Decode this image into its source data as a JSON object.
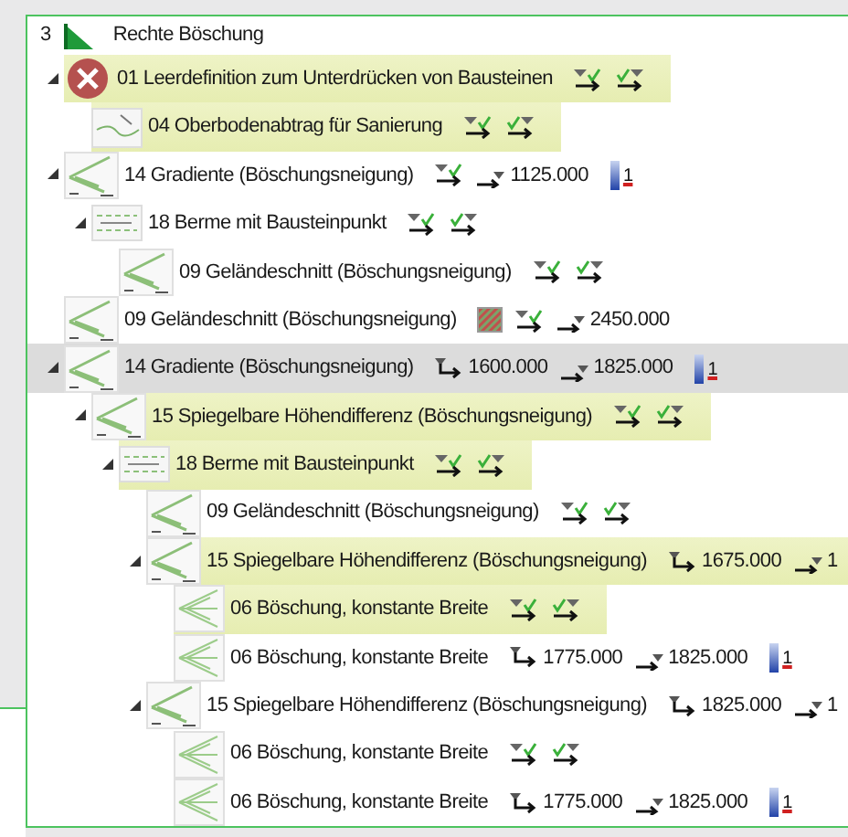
{
  "header": {
    "number": "3",
    "label": "Rechte Böschung"
  },
  "tree": [
    {
      "label": "01 Leerdefinition zum Unterdrücken von Bausteinen",
      "kind": "error",
      "expanded": true,
      "selected": false,
      "highlighted": true,
      "cells": [
        {
          "kind": "check-in"
        },
        {
          "kind": "check-out"
        }
      ],
      "children": [
        {
          "label": "04 Oberbodenabtrag für Sanierung",
          "kind": "topsoil",
          "selected": false,
          "highlighted": true,
          "cells": [
            {
              "kind": "check-in"
            },
            {
              "kind": "check-out"
            }
          ]
        }
      ]
    },
    {
      "label": "14 Gradiente (Böschungsneigung)",
      "kind": "slope",
      "expanded": true,
      "selected": false,
      "highlighted": false,
      "cells": [
        {
          "kind": "check-in"
        },
        {
          "kind": "out-value",
          "text": "1125.000"
        },
        {
          "kind": "bar",
          "text": "1"
        }
      ],
      "children": [
        {
          "label": "18 Berme mit Bausteinpunkt",
          "kind": "berm",
          "expanded": true,
          "selected": false,
          "highlighted": false,
          "cells": [
            {
              "kind": "check-in"
            },
            {
              "kind": "check-out"
            }
          ],
          "children": [
            {
              "label": "09 Geländeschnitt (Böschungsneigung)",
              "kind": "slope",
              "selected": false,
              "highlighted": false,
              "cells": [
                {
                  "kind": "check-in"
                },
                {
                  "kind": "check-out"
                }
              ]
            }
          ]
        }
      ]
    },
    {
      "label": "09 Geländeschnitt (Böschungsneigung)",
      "kind": "slope",
      "selected": false,
      "highlighted": false,
      "cells": [
        {
          "kind": "hatch"
        },
        {
          "kind": "check-in"
        },
        {
          "kind": "out-value",
          "text": "2450.000"
        }
      ]
    },
    {
      "label": "14 Gradiente (Böschungsneigung)",
      "kind": "slope",
      "expanded": true,
      "selected": true,
      "highlighted": false,
      "cells": [
        {
          "kind": "in-value",
          "text": "1600.000"
        },
        {
          "kind": "out-value",
          "text": "1825.000"
        },
        {
          "kind": "bar",
          "text": "1"
        }
      ],
      "children": [
        {
          "label": "15 Spiegelbare Höhendifferenz (Böschungsneigung)",
          "kind": "slope",
          "expanded": true,
          "selected": false,
          "highlighted": true,
          "cells": [
            {
              "kind": "check-in"
            },
            {
              "kind": "check-out"
            }
          ],
          "children": [
            {
              "label": "18 Berme mit Bausteinpunkt",
              "kind": "berm",
              "expanded": true,
              "selected": false,
              "highlighted": true,
              "cells": [
                {
                  "kind": "check-in"
                },
                {
                  "kind": "check-out"
                }
              ],
              "children": [
                {
                  "label": "09 Geländeschnitt (Böschungsneigung)",
                  "kind": "slope",
                  "selected": false,
                  "highlighted": false,
                  "cells": [
                    {
                      "kind": "check-in"
                    },
                    {
                      "kind": "check-out"
                    }
                  ]
                },
                {
                  "label": "15 Spiegelbare Höhendifferenz (Böschungsneigung)",
                  "kind": "slope",
                  "expanded": true,
                  "selected": false,
                  "highlighted": true,
                  "cells": [
                    {
                      "kind": "in-value",
                      "text": "1675.000"
                    },
                    {
                      "kind": "out-value",
                      "text": "1"
                    }
                  ],
                  "children": [
                    {
                      "label": "06 Böschung, konstante Breite",
                      "kind": "fan",
                      "selected": false,
                      "highlighted": true,
                      "cells": [
                        {
                          "kind": "check-in"
                        },
                        {
                          "kind": "check-out"
                        }
                      ]
                    },
                    {
                      "label": "06 Böschung, konstante Breite",
                      "kind": "fan",
                      "selected": false,
                      "highlighted": false,
                      "cells": [
                        {
                          "kind": "in-value",
                          "text": "1775.000"
                        },
                        {
                          "kind": "out-value",
                          "text": "1825.000"
                        },
                        {
                          "kind": "bar",
                          "text": "1"
                        }
                      ]
                    }
                  ]
                },
                {
                  "label": "15 Spiegelbare Höhendifferenz (Böschungsneigung)",
                  "kind": "slope",
                  "expanded": true,
                  "selected": false,
                  "highlighted": false,
                  "cells": [
                    {
                      "kind": "in-value",
                      "text": "1825.000"
                    },
                    {
                      "kind": "out-value",
                      "text": "1"
                    }
                  ],
                  "children": [
                    {
                      "label": "06 Böschung, konstante Breite",
                      "kind": "fan",
                      "selected": false,
                      "highlighted": false,
                      "cells": [
                        {
                          "kind": "check-in"
                        },
                        {
                          "kind": "check-out"
                        }
                      ]
                    },
                    {
                      "label": "06 Böschung, konstante Breite",
                      "kind": "fan",
                      "selected": false,
                      "highlighted": false,
                      "cells": [
                        {
                          "kind": "in-value",
                          "text": "1775.000"
                        },
                        {
                          "kind": "out-value",
                          "text": "1825.000"
                        },
                        {
                          "kind": "bar",
                          "text": "1"
                        }
                      ]
                    }
                  ]
                }
              ]
            }
          ]
        }
      ]
    }
  ]
}
